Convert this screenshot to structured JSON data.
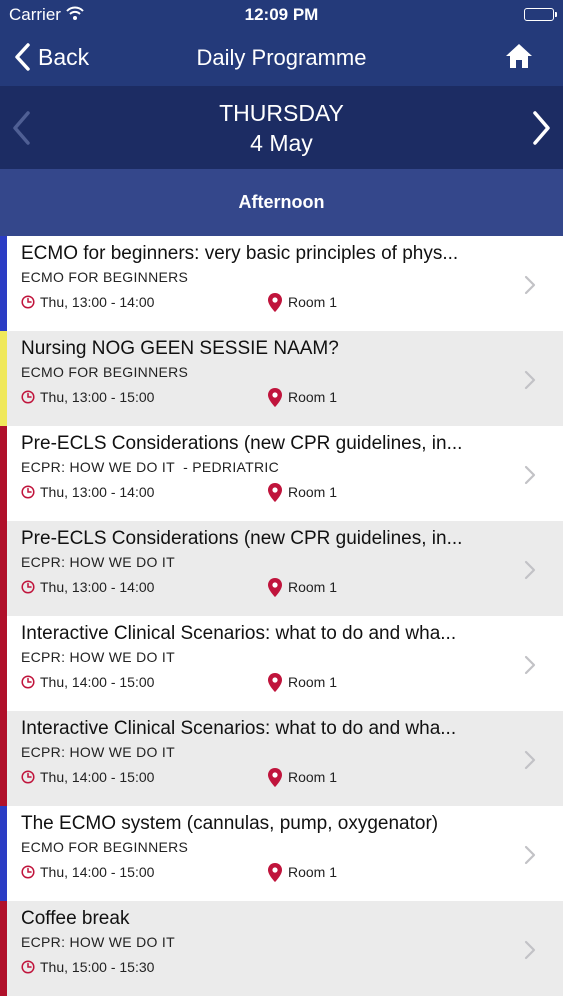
{
  "status_bar": {
    "carrier": "Carrier",
    "time": "12:09 PM"
  },
  "nav": {
    "back_label": "Back",
    "title": "Daily Programme"
  },
  "day": {
    "name": "THURSDAY",
    "date": "4 May"
  },
  "section": {
    "label": "Afternoon"
  },
  "colors": {
    "nav_bg": "#243a7a",
    "day_bg": "#1c2c63",
    "section_bg": "#34478b",
    "accent_red": "#c0143c"
  },
  "sessions": [
    {
      "title": "ECMO for beginners: very basic principles of phys...",
      "track": "ECMO FOR BEGINNERS",
      "time": "Thu, 13:00 - 14:00",
      "room": "Room 1",
      "stripe_color": "#2b3cc4"
    },
    {
      "title": "Nursing NOG GEEN SESSIE NAAM?",
      "track": "ECMO FOR BEGINNERS",
      "time": "Thu, 13:00 - 15:00",
      "room": "Room 1",
      "stripe_color": "#f0e85a"
    },
    {
      "title": "Pre-ECLS Considerations (new CPR guidelines, in...",
      "track": "ECPR: HOW WE DO IT  - PEDRIATRIC",
      "time": "Thu, 13:00 - 14:00",
      "room": "Room 1",
      "stripe_color": "#b0102a"
    },
    {
      "title": "Pre-ECLS Considerations (new CPR guidelines, in...",
      "track": "ECPR: HOW WE DO IT",
      "time": "Thu, 13:00 - 14:00",
      "room": "Room 1",
      "stripe_color": "#b0102a"
    },
    {
      "title": "Interactive Clinical Scenarios: what to do and wha...",
      "track": "ECPR: HOW WE DO IT",
      "time": "Thu, 14:00 - 15:00",
      "room": "Room 1",
      "stripe_color": "#b0102a"
    },
    {
      "title": "Interactive Clinical Scenarios: what to do and wha...",
      "track": "ECPR: HOW WE DO IT",
      "time": "Thu, 14:00 - 15:00",
      "room": "Room 1",
      "stripe_color": "#b0102a"
    },
    {
      "title": "The ECMO system (cannulas, pump, oxygenator)",
      "track": "ECMO FOR BEGINNERS",
      "time": "Thu, 14:00 - 15:00",
      "room": "Room 1",
      "stripe_color": "#2b3cc4"
    },
    {
      "title": "Coffee break",
      "track": "ECPR: HOW WE DO IT",
      "time": "Thu, 15:00 - 15:30",
      "room": "",
      "stripe_color": "#b0102a"
    }
  ]
}
